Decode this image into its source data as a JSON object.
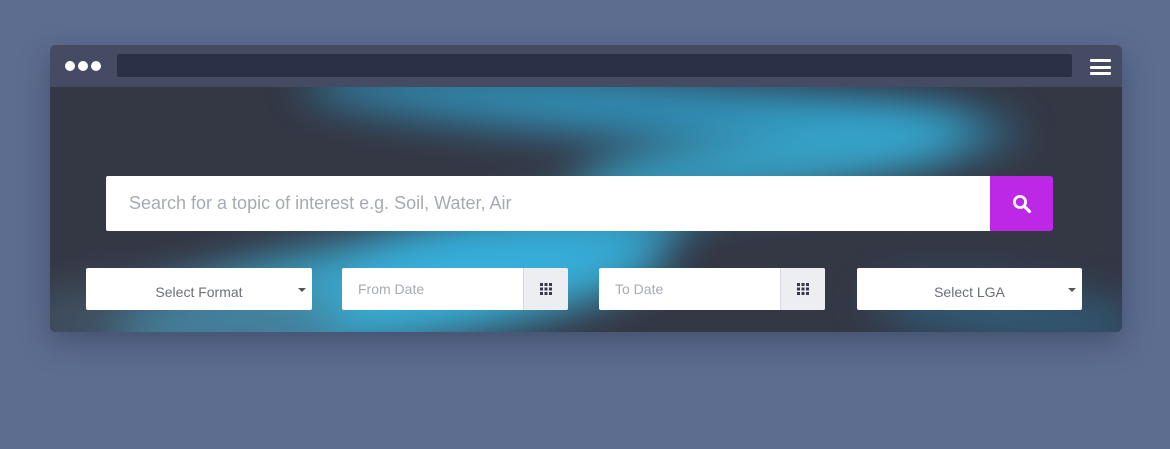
{
  "search": {
    "placeholder": "Search for a topic of interest e.g. Soil, Water, Air",
    "button_icon": "search-icon",
    "button_color": "#bd28e6"
  },
  "filters": {
    "format_label": "Select Format",
    "from_date_placeholder": "From Date",
    "to_date_placeholder": "To Date",
    "lga_label": "Select LGA",
    "calendar_icon": "calendar-grid-icon"
  },
  "colors": {
    "page_background": "#5d6d90",
    "titlebar": "#444b63",
    "hero_background": "#343744",
    "hero_glow": "#38c2f0"
  }
}
